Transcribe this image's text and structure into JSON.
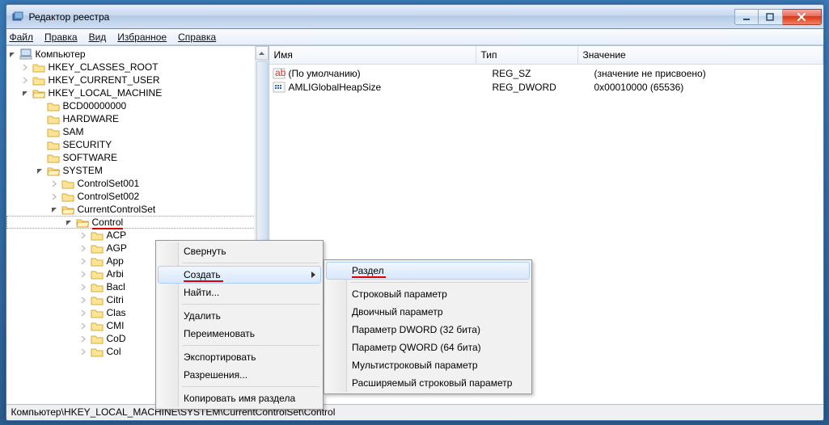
{
  "title": "Редактор реестра",
  "menu": {
    "file": "Файл",
    "edit": "Правка",
    "view": "Вид",
    "fav": "Избранное",
    "help": "Справка"
  },
  "tree": {
    "root": "Компьютер",
    "hkc": "HKEY_CLASSES_ROOT",
    "hku": "HKEY_CURRENT_USER",
    "hklm": "HKEY_LOCAL_MACHINE",
    "bcd": "BCD00000000",
    "hardware": "HARDWARE",
    "sam": "SAM",
    "security": "SECURITY",
    "software": "SOFTWARE",
    "system": "SYSTEM",
    "cs1": "ControlSet001",
    "cs2": "ControlSet002",
    "ccs": "CurrentControlSet",
    "control": "Control",
    "sub": [
      "ACP",
      "AGP",
      "App",
      "Arbi",
      "Bacl",
      "Citri",
      "Clas",
      "CMI",
      "CoD",
      "Col"
    ]
  },
  "cols": {
    "name": "Имя",
    "type": "Тип",
    "value": "Значение"
  },
  "rows": [
    {
      "name": "(По умолчанию)",
      "type": "REG_SZ",
      "value": "(значение не присвоено)",
      "icon": "sz"
    },
    {
      "name": "AMLIGlobalHeapSize",
      "type": "REG_DWORD",
      "value": "0x00010000 (65536)",
      "icon": "dw"
    }
  ],
  "ctx1": {
    "collapse": "Свернуть",
    "create": "Создать",
    "find": "Найти...",
    "delete": "Удалить",
    "rename": "Переименовать",
    "export": "Экспортировать",
    "perms": "Разрешения...",
    "copyname": "Копировать имя раздела"
  },
  "ctx2": {
    "key": "Раздел",
    "string": "Строковый параметр",
    "binary": "Двоичный параметр",
    "dword": "Параметр DWORD (32 бита)",
    "qword": "Параметр QWORD (64 бита)",
    "multi": "Мультистроковый параметр",
    "expand": "Расширяемый строковый параметр"
  },
  "status": "Компьютер\\HKEY_LOCAL_MACHINE\\SYSTEM\\CurrentControlSet\\Control"
}
